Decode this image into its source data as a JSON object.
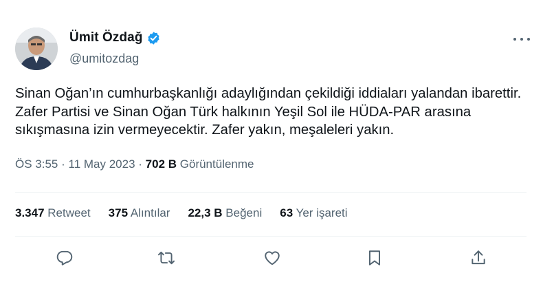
{
  "author": {
    "display_name": "Ümit Özdağ",
    "handle": "@umitozdag",
    "verified": true
  },
  "tweet": {
    "text": "Sinan Oğan’ın cumhurbaşkanlığı adaylığından çekildiği iddiaları yalandan ibarettir. Zafer Partisi ve Sinan Oğan Türk halkının Yeşil Sol ile HÜDA-PAR arasına sıkışmasına izin vermeyecektir. Zafer yakın, meşaleleri yakın.",
    "time": "ÖS 3:55",
    "date": "11 May 2023",
    "views_count": "702 B",
    "views_label": "Görüntülenme"
  },
  "stats": {
    "retweets_count": "3.347",
    "retweets_label": "Retweet",
    "quotes_count": "375",
    "quotes_label": "Alıntılar",
    "likes_count": "22,3 B",
    "likes_label": "Beğeni",
    "bookmarks_count": "63",
    "bookmarks_label": "Yer işareti"
  },
  "icons": {
    "verified": "verified-badge-icon",
    "more": "more-horizontal-icon",
    "reply": "reply-icon",
    "retweet": "retweet-icon",
    "like": "heart-icon",
    "bookmark": "bookmark-icon",
    "share": "share-icon"
  },
  "colors": {
    "verified_blue": "#1d9bf0",
    "secondary_text": "#536471",
    "primary_text": "#0f1419",
    "divider": "#eff3f4"
  }
}
